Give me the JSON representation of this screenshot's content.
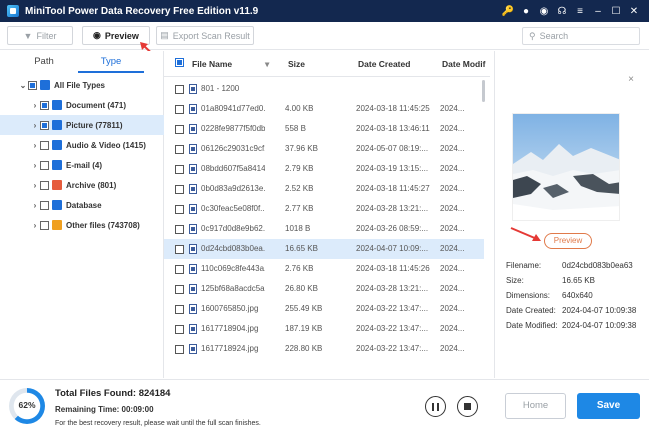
{
  "window": {
    "title": "MiniTool Power Data Recovery Free Edition v11.9"
  },
  "toolbar": {
    "filter_label": "Filter",
    "preview_label": "Preview",
    "export_label": "Export Scan Result",
    "search_placeholder": "Search"
  },
  "sidebar": {
    "tabs": [
      "Path",
      "Type"
    ],
    "active_tab": "Type",
    "items": [
      {
        "label": "All File Types",
        "arrow": "⌄",
        "checkbox": "partial",
        "icon_color": "#1e6fd9",
        "level": 0
      },
      {
        "label": "Document (471)",
        "arrow": "›",
        "checkbox": "partial",
        "icon_color": "#1e6fd9",
        "level": 1
      },
      {
        "label": "Picture (77811)",
        "arrow": "›",
        "checkbox": "partial",
        "icon_color": "#1e6fd9",
        "level": 1,
        "selected": true
      },
      {
        "label": "Audio & Video (1415)",
        "arrow": "›",
        "checkbox": "empty",
        "icon_color": "#1e6fd9",
        "level": 1
      },
      {
        "label": "E-mail (4)",
        "arrow": "›",
        "checkbox": "empty",
        "icon_color": "#1e6fd9",
        "level": 1
      },
      {
        "label": "Archive (801)",
        "arrow": "›",
        "checkbox": "empty",
        "icon_color": "#e65c3c",
        "level": 1
      },
      {
        "label": "Database",
        "arrow": "›",
        "checkbox": "empty",
        "icon_color": "#1e6fd9",
        "level": 1
      },
      {
        "label": "Other files (743708)",
        "arrow": "›",
        "checkbox": "empty",
        "icon_color": "#f0a020",
        "level": 1
      }
    ]
  },
  "file_list": {
    "columns": [
      "File Name",
      "Size",
      "Date Created",
      "Date Modif"
    ],
    "rows": [
      {
        "name": "801 - 1200",
        "size": "",
        "created": "",
        "modified": ""
      },
      {
        "name": "01a80941d77ed0...",
        "size": "4.00 KB",
        "created": "2024-03-18 11:45:25",
        "modified": "2024..."
      },
      {
        "name": "0228fe9877f5f0db...",
        "size": "558 B",
        "created": "2024-03-18 13:46:11",
        "modified": "2024..."
      },
      {
        "name": "06126c29031c9cf...",
        "size": "37.96 KB",
        "created": "2024-05-07 08:19:...",
        "modified": "2024..."
      },
      {
        "name": "08bdd607f5a8414...",
        "size": "2.79 KB",
        "created": "2024-03-19 13:15:...",
        "modified": "2024..."
      },
      {
        "name": "0b0d83a9d2613e...",
        "size": "2.52 KB",
        "created": "2024-03-18 11:45:27",
        "modified": "2024..."
      },
      {
        "name": "0c30feac5e08f0f...",
        "size": "2.77 KB",
        "created": "2024-03-28 13:21:...",
        "modified": "2024..."
      },
      {
        "name": "0c917d0d8e9b62...",
        "size": "1018 B",
        "created": "2024-03-26 08:59:...",
        "modified": "2024..."
      },
      {
        "name": "0d24cbd083b0ea...",
        "size": "16.65 KB",
        "created": "2024-04-07 10:09:...",
        "modified": "2024...",
        "selected": true
      },
      {
        "name": "110c069c8fe443a...",
        "size": "2.76 KB",
        "created": "2024-03-18 11:45:26",
        "modified": "2024..."
      },
      {
        "name": "125bf68a8acdc5a...",
        "size": "26.80 KB",
        "created": "2024-03-28 13:21:...",
        "modified": "2024..."
      },
      {
        "name": "1600765850.jpg",
        "size": "255.49 KB",
        "created": "2024-03-22 13:47:...",
        "modified": "2024..."
      },
      {
        "name": "1617718904.jpg",
        "size": "187.19 KB",
        "created": "2024-03-22 13:47:...",
        "modified": "2024..."
      },
      {
        "name": "1617718924.jpg",
        "size": "228.80 KB",
        "created": "2024-03-22 13:47:...",
        "modified": "2024..."
      }
    ]
  },
  "preview_panel": {
    "close_glyph": "×",
    "preview_button": "Preview",
    "properties": [
      {
        "key": "Filename:",
        "value": "0d24cbd083b0ea63"
      },
      {
        "key": "Size:",
        "value": "16.65 KB"
      },
      {
        "key": "Dimensions:",
        "value": "640x640"
      },
      {
        "key": "Date Created:",
        "value": "2024-04-07 10:09:38"
      },
      {
        "key": "Date Modified:",
        "value": "2024-04-07 10:09:38"
      }
    ]
  },
  "status": {
    "progress_percent": 62,
    "progress_label": "62%",
    "total_files": "Total Files Found:  824184",
    "remaining": "Remaining Time:  00:09:00",
    "hint": "For the best recovery result, please wait until the full scan finishes.",
    "home_label": "Home",
    "save_label": "Save"
  },
  "colors": {
    "accent": "#1e88e5",
    "titlebar": "#13284f",
    "selection": "#dcebfb",
    "annotation": "#e53935"
  }
}
